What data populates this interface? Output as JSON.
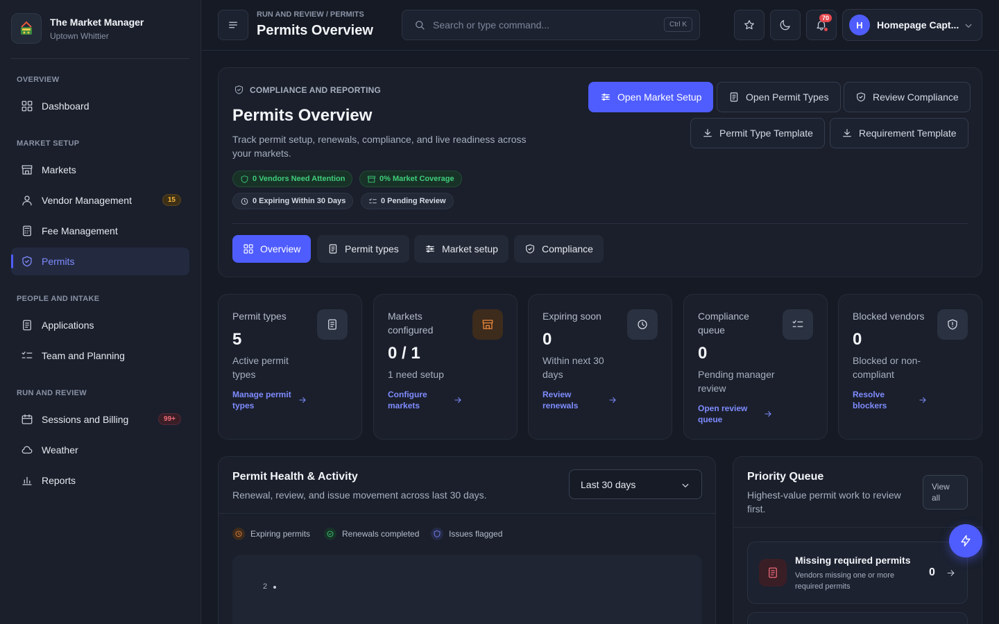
{
  "brand": {
    "title": "The Market Manager",
    "subtitle": "Uptown Whittier",
    "logo_icon": "market-basket-icon"
  },
  "sidebar": {
    "sections": [
      {
        "label": "OVERVIEW"
      },
      {
        "label": "MARKET SETUP"
      },
      {
        "label": "PEOPLE AND INTAKE"
      },
      {
        "label": "RUN AND REVIEW"
      }
    ],
    "items": [
      {
        "label": "Dashboard",
        "icon": "grid-icon"
      },
      {
        "label": "Markets",
        "icon": "storefront-icon"
      },
      {
        "label": "Vendor Management",
        "icon": "user-icon",
        "badge": "15"
      },
      {
        "label": "Fee Management",
        "icon": "calculator-icon"
      },
      {
        "label": "Permits",
        "icon": "shield-icon",
        "active": true
      },
      {
        "label": "Applications",
        "icon": "document-icon"
      },
      {
        "label": "Team and Planning",
        "icon": "checklist-icon"
      },
      {
        "label": "Sessions and Billing",
        "icon": "calendar-icon",
        "badge": "99+"
      },
      {
        "label": "Weather",
        "icon": "cloud-icon"
      },
      {
        "label": "Reports",
        "icon": "bar-chart-icon"
      }
    ]
  },
  "header": {
    "breadcrumb": "RUN AND REVIEW / PERMITS",
    "title": "Permits Overview",
    "search_placeholder": "Search or type command...",
    "shortcut": "Ctrl K",
    "notification_count": "70",
    "user_initial": "H",
    "user_name": "Homepage Capt..."
  },
  "hero": {
    "eyebrow": "COMPLIANCE AND REPORTING",
    "title": "Permits Overview",
    "description": "Track permit setup, renewals, compliance, and live readiness across your markets.",
    "chips": [
      {
        "label": "0 Vendors Need Attention",
        "tone": "green"
      },
      {
        "label": "0% Market Coverage",
        "tone": "green"
      },
      {
        "label": "0 Expiring Within 30 Days",
        "tone": "gray"
      },
      {
        "label": "0 Pending Review",
        "tone": "gray"
      }
    ],
    "actions": [
      {
        "label": "Open Market Setup",
        "primary": true
      },
      {
        "label": "Open Permit Types"
      },
      {
        "label": "Review Compliance"
      },
      {
        "label": "Permit Type Template"
      },
      {
        "label": "Requirement Template"
      }
    ],
    "tabs": [
      {
        "label": "Overview",
        "active": true
      },
      {
        "label": "Permit types"
      },
      {
        "label": "Market setup"
      },
      {
        "label": "Compliance"
      }
    ]
  },
  "stats": [
    {
      "label": "Permit types",
      "value": "5",
      "sub": "Active permit types",
      "link": "Manage permit types",
      "icon": "document-icon"
    },
    {
      "label": "Markets configured",
      "value": "0 / 1",
      "sub": "1 need setup",
      "link": "Configure markets",
      "icon": "storefront-icon"
    },
    {
      "label": "Expiring soon",
      "value": "0",
      "sub": "Within next 30 days",
      "link": "Review renewals",
      "icon": "clock-icon"
    },
    {
      "label": "Compliance queue",
      "value": "0",
      "sub": "Pending manager review",
      "link": "Open review queue",
      "icon": "checklist-icon"
    },
    {
      "label": "Blocked vendors",
      "value": "0",
      "sub": "Blocked or non-compliant",
      "link": "Resolve blockers",
      "icon": "shield-alert-icon"
    }
  ],
  "health": {
    "title": "Permit Health & Activity",
    "subtitle": "Renewal, review, and issue movement across last 30 days.",
    "range": "Last 30 days",
    "legend": [
      {
        "label": "Expiring permits",
        "color": "#f0883e"
      },
      {
        "label": "Renewals completed",
        "color": "#3fce7a"
      },
      {
        "label": "Issues flagged",
        "color": "#7f8cff"
      }
    ],
    "y_tick": "2"
  },
  "priority": {
    "title": "Priority Queue",
    "subtitle": "Highest-value permit work to review first.",
    "view_all": "View all",
    "items": [
      {
        "title": "Missing required permits",
        "desc": "Vendors missing one or more required permits",
        "count": "0"
      }
    ]
  }
}
